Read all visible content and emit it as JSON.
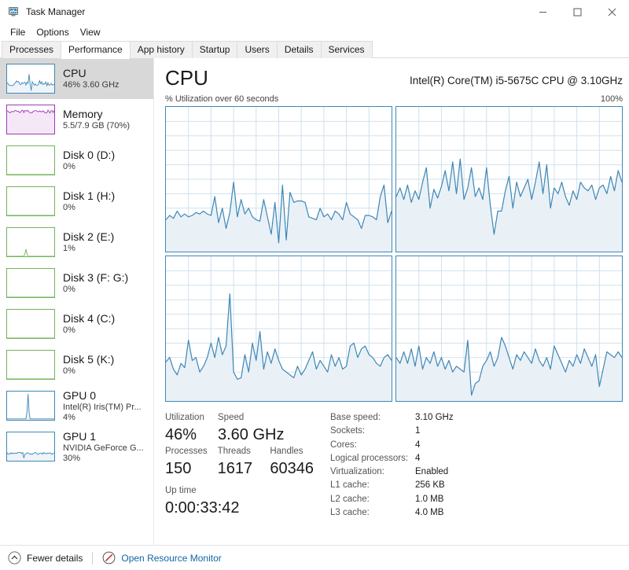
{
  "window": {
    "title": "Task Manager",
    "icon": "task-manager-icon",
    "controls": {
      "minimize": "—",
      "maximize": "❑",
      "close": "✕"
    }
  },
  "menu": {
    "items": [
      "File",
      "Options",
      "View"
    ]
  },
  "tabs": {
    "items": [
      "Processes",
      "Performance",
      "App history",
      "Startup",
      "Users",
      "Details",
      "Services"
    ],
    "active": "Performance"
  },
  "sidebar": {
    "items": [
      {
        "title": "CPU",
        "sub": "46%  3.60 GHz",
        "sub2": "",
        "color": "#3f87b5",
        "selected": true,
        "kind": "cpu"
      },
      {
        "title": "Memory",
        "sub": "5.5/7.9 GB (70%)",
        "sub2": "",
        "color": "#a337b5",
        "selected": false,
        "kind": "memory"
      },
      {
        "title": "Disk 0 (D:)",
        "sub": "0%",
        "sub2": "",
        "color": "#73b35b",
        "selected": false,
        "kind": "flat"
      },
      {
        "title": "Disk 1 (H:)",
        "sub": "0%",
        "sub2": "",
        "color": "#73b35b",
        "selected": false,
        "kind": "flat"
      },
      {
        "title": "Disk 2 (E:)",
        "sub": "1%",
        "sub2": "",
        "color": "#73b35b",
        "selected": false,
        "kind": "spike"
      },
      {
        "title": "Disk 3 (F: G:)",
        "sub": "0%",
        "sub2": "",
        "color": "#73b35b",
        "selected": false,
        "kind": "flat"
      },
      {
        "title": "Disk 4 (C:)",
        "sub": "0%",
        "sub2": "",
        "color": "#73b35b",
        "selected": false,
        "kind": "flat"
      },
      {
        "title": "Disk 5 (K:)",
        "sub": "0%",
        "sub2": "",
        "color": "#73b35b",
        "selected": false,
        "kind": "flat"
      },
      {
        "title": "GPU 0",
        "sub": "Intel(R) Iris(TM) Pr...",
        "sub2": "4%",
        "color": "#3f87b5",
        "selected": false,
        "kind": "gpu0"
      },
      {
        "title": "GPU 1",
        "sub": "NVIDIA GeForce G...",
        "sub2": "30%",
        "color": "#3f87b5",
        "selected": false,
        "kind": "gpu1"
      }
    ]
  },
  "main": {
    "title": "CPU",
    "cpu_model": "Intel(R) Core(TM) i5-5675C CPU @ 3.10GHz",
    "graph_caption_left": "% Utilization over 60 seconds",
    "graph_caption_right": "100%",
    "stats": {
      "utilization_label": "Utilization",
      "utilization_value": "46%",
      "speed_label": "Speed",
      "speed_value": "3.60 GHz",
      "processes_label": "Processes",
      "processes_value": "150",
      "threads_label": "Threads",
      "threads_value": "1617",
      "handles_label": "Handles",
      "handles_value": "60346",
      "uptime_label": "Up time",
      "uptime_value": "0:00:33:42"
    },
    "specs": [
      {
        "label": "Base speed:",
        "value": "3.10 GHz"
      },
      {
        "label": "Sockets:",
        "value": "1"
      },
      {
        "label": "Cores:",
        "value": "4"
      },
      {
        "label": "Logical processors:",
        "value": "4"
      },
      {
        "label": "Virtualization:",
        "value": "Enabled"
      },
      {
        "label": "L1 cache:",
        "value": "256 KB"
      },
      {
        "label": "L2 cache:",
        "value": "1.0 MB"
      },
      {
        "label": "L3 cache:",
        "value": "4.0 MB"
      }
    ]
  },
  "statusbar": {
    "fewer_details": "Fewer details",
    "open_resource_monitor": "Open Resource Monitor"
  },
  "colors": {
    "cpu_accent": "#3f87b5",
    "cpu_fill": "#e9f1f7",
    "grid": "#cfe1ee",
    "memory_accent": "#a337b5",
    "disk_accent": "#73b35b",
    "link": "#1464a5",
    "selection": "#d8d8d8"
  },
  "chart_data": {
    "type": "line",
    "title": "% Utilization over 60 seconds",
    "xlabel": "60 seconds",
    "ylabel": "% Utilization",
    "ylim": [
      0,
      100
    ],
    "xlim": [
      0,
      60
    ],
    "grid": true,
    "legend": "none",
    "panels": 4,
    "panel_note": "One graph per logical processor (4 logical processors)",
    "series": [
      {
        "name": "CPU 0",
        "values": [
          22,
          25,
          23,
          28,
          24,
          26,
          24,
          25,
          27,
          26,
          28,
          26,
          25,
          38,
          20,
          30,
          16,
          27,
          48,
          24,
          36,
          26,
          30,
          24,
          22,
          21,
          36,
          24,
          12,
          34,
          6,
          46,
          8,
          41,
          34,
          35,
          35,
          34,
          24,
          23,
          22,
          30,
          24,
          26,
          22,
          28,
          26,
          22,
          34,
          26,
          24,
          22,
          16,
          25,
          25,
          24,
          22,
          38,
          46,
          20,
          28
        ]
      },
      {
        "name": "CPU 1",
        "values": [
          38,
          44,
          36,
          46,
          34,
          42,
          36,
          48,
          58,
          30,
          43,
          37,
          45,
          56,
          42,
          62,
          40,
          64,
          36,
          44,
          58,
          38,
          44,
          36,
          58,
          32,
          12,
          28,
          28,
          42,
          52,
          30,
          48,
          38,
          44,
          50,
          36,
          48,
          62,
          40,
          60,
          30,
          44,
          40,
          48,
          38,
          32,
          42,
          36,
          48,
          44,
          42,
          46,
          36,
          44,
          46,
          40,
          52,
          42,
          56,
          48
        ]
      },
      {
        "name": "CPU 2",
        "values": [
          27,
          30,
          22,
          18,
          26,
          23,
          42,
          28,
          30,
          20,
          24,
          30,
          40,
          30,
          44,
          32,
          38,
          74,
          20,
          15,
          16,
          32,
          20,
          40,
          28,
          48,
          22,
          34,
          26,
          36,
          28,
          22,
          20,
          18,
          16,
          24,
          18,
          22,
          28,
          34,
          22,
          28,
          24,
          20,
          32,
          24,
          30,
          22,
          24,
          38,
          40,
          30,
          36,
          38,
          32,
          30,
          26,
          24,
          30,
          32,
          28
        ]
      },
      {
        "name": "CPU 3",
        "values": [
          30,
          26,
          34,
          26,
          36,
          24,
          38,
          22,
          30,
          26,
          34,
          24,
          30,
          22,
          28,
          20,
          24,
          22,
          20,
          42,
          4,
          12,
          14,
          24,
          28,
          34,
          24,
          30,
          44,
          38,
          30,
          22,
          32,
          28,
          34,
          30,
          26,
          36,
          28,
          24,
          30,
          22,
          38,
          32,
          26,
          20,
          28,
          24,
          32,
          26,
          36,
          30,
          24,
          32,
          10,
          22,
          34,
          32,
          30,
          34,
          30
        ]
      }
    ]
  }
}
